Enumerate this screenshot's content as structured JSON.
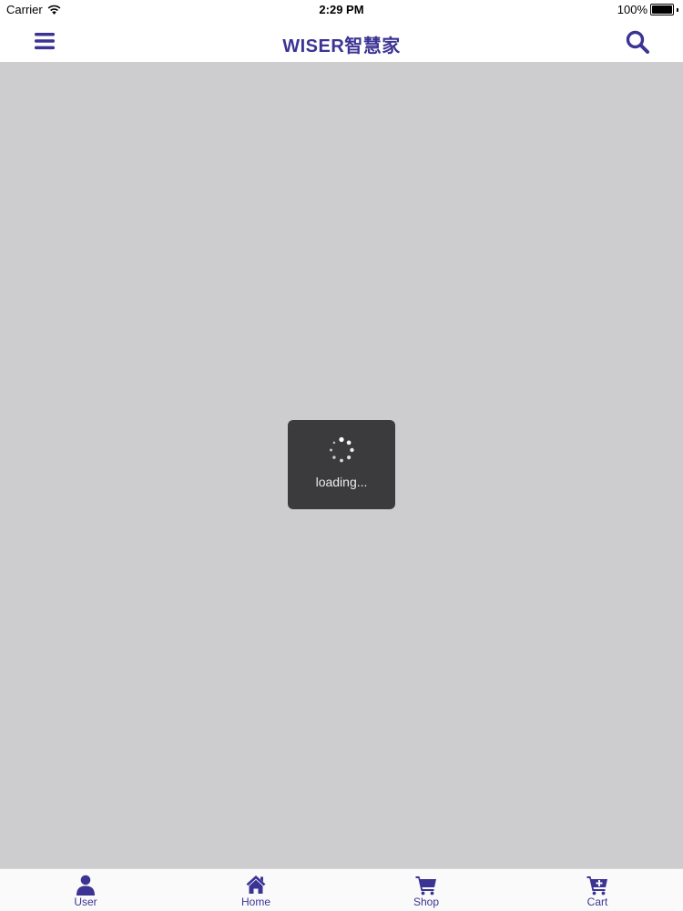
{
  "status_bar": {
    "carrier": "Carrier",
    "time": "2:29 PM",
    "battery_text": "100%",
    "battery_level": 1.0
  },
  "nav_bar": {
    "title": "WISER智慧家",
    "menu_icon": "hamburger-menu-icon",
    "search_icon": "search-icon"
  },
  "loading": {
    "text": "loading..."
  },
  "tab_bar": {
    "items": [
      {
        "label": "User",
        "icon": "user-icon"
      },
      {
        "label": "Home",
        "icon": "home-icon"
      },
      {
        "label": "Shop",
        "icon": "shopping-cart-icon"
      },
      {
        "label": "Cart",
        "icon": "cart-add-icon"
      }
    ]
  },
  "colors": {
    "brand": "#3c3494",
    "content_background": "#cdccce",
    "hud_background": "#3b3a3c"
  }
}
